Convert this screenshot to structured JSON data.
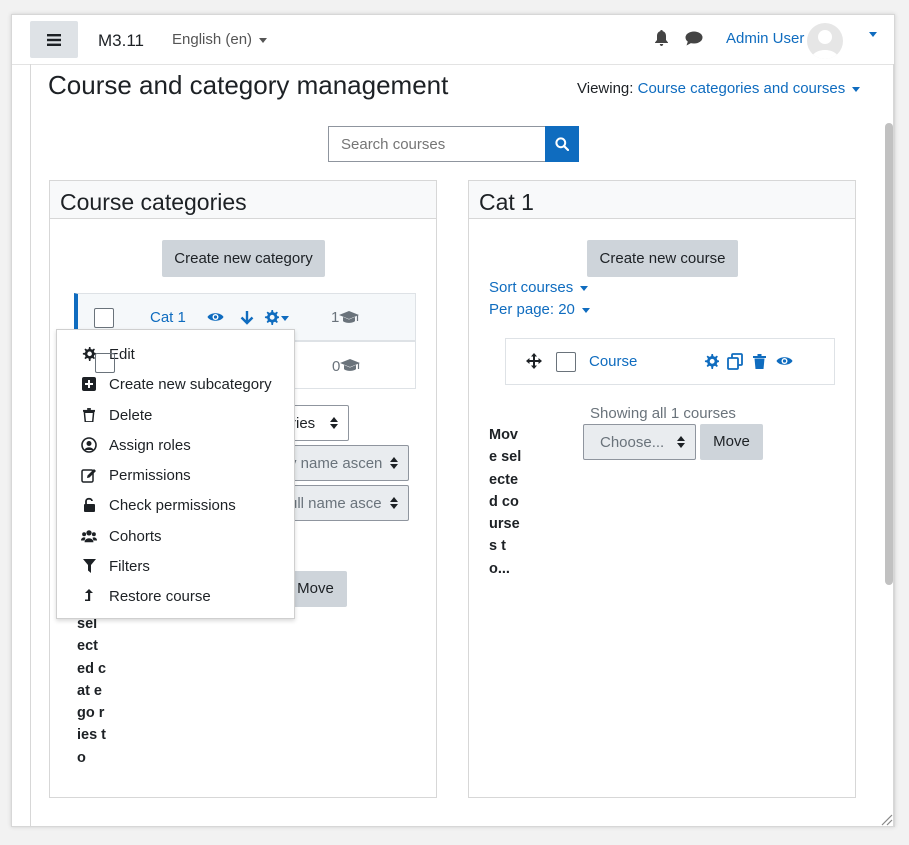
{
  "navbar": {
    "brand": "M3.11",
    "language": "English (en)",
    "user_name": "Admin User"
  },
  "page": {
    "title": "Course and category management",
    "viewing_label": "Viewing:",
    "viewing_value": "Course categories and courses",
    "search_placeholder": "Search courses"
  },
  "categories_panel": {
    "heading": "Course categories",
    "create_button": "Create new category",
    "rows": [
      {
        "name": "Cat 1",
        "count": "1"
      },
      {
        "name": "",
        "count": "0"
      }
    ],
    "sort_select_visible_1": "ries",
    "sort_select_visible_2": "y name ascen",
    "sort_select_visible_3": "ull name asce",
    "move_button": "Move",
    "move_label_partial": "sel ect ed cat ego ries to"
  },
  "context_menu": {
    "items": [
      {
        "label": "Edit",
        "icon": "gear-icon"
      },
      {
        "label": "Create new subcategory",
        "icon": "plus-square-icon"
      },
      {
        "label": "Delete",
        "icon": "trash-icon"
      },
      {
        "label": "Assign roles",
        "icon": "user-circle-icon"
      },
      {
        "label": "Permissions",
        "icon": "pencil-square-icon"
      },
      {
        "label": "Check permissions",
        "icon": "unlock-icon"
      },
      {
        "label": "Cohorts",
        "icon": "users-icon"
      },
      {
        "label": "Filters",
        "icon": "filter-icon"
      },
      {
        "label": "Restore course",
        "icon": "restore-icon"
      }
    ]
  },
  "courses_panel": {
    "heading": "Cat 1",
    "create_button": "Create new course",
    "sort_link": "Sort courses",
    "per_page_link": "Per page: 20",
    "course_name": "Course",
    "showing": "Showing all 1 courses",
    "move_label": "Move selected courses to...",
    "choose_placeholder": "Choose...",
    "move_button": "Move"
  },
  "colors": {
    "accent": "#0f6cbf",
    "button_grey": "#ced4da",
    "text": "#1d2125"
  }
}
